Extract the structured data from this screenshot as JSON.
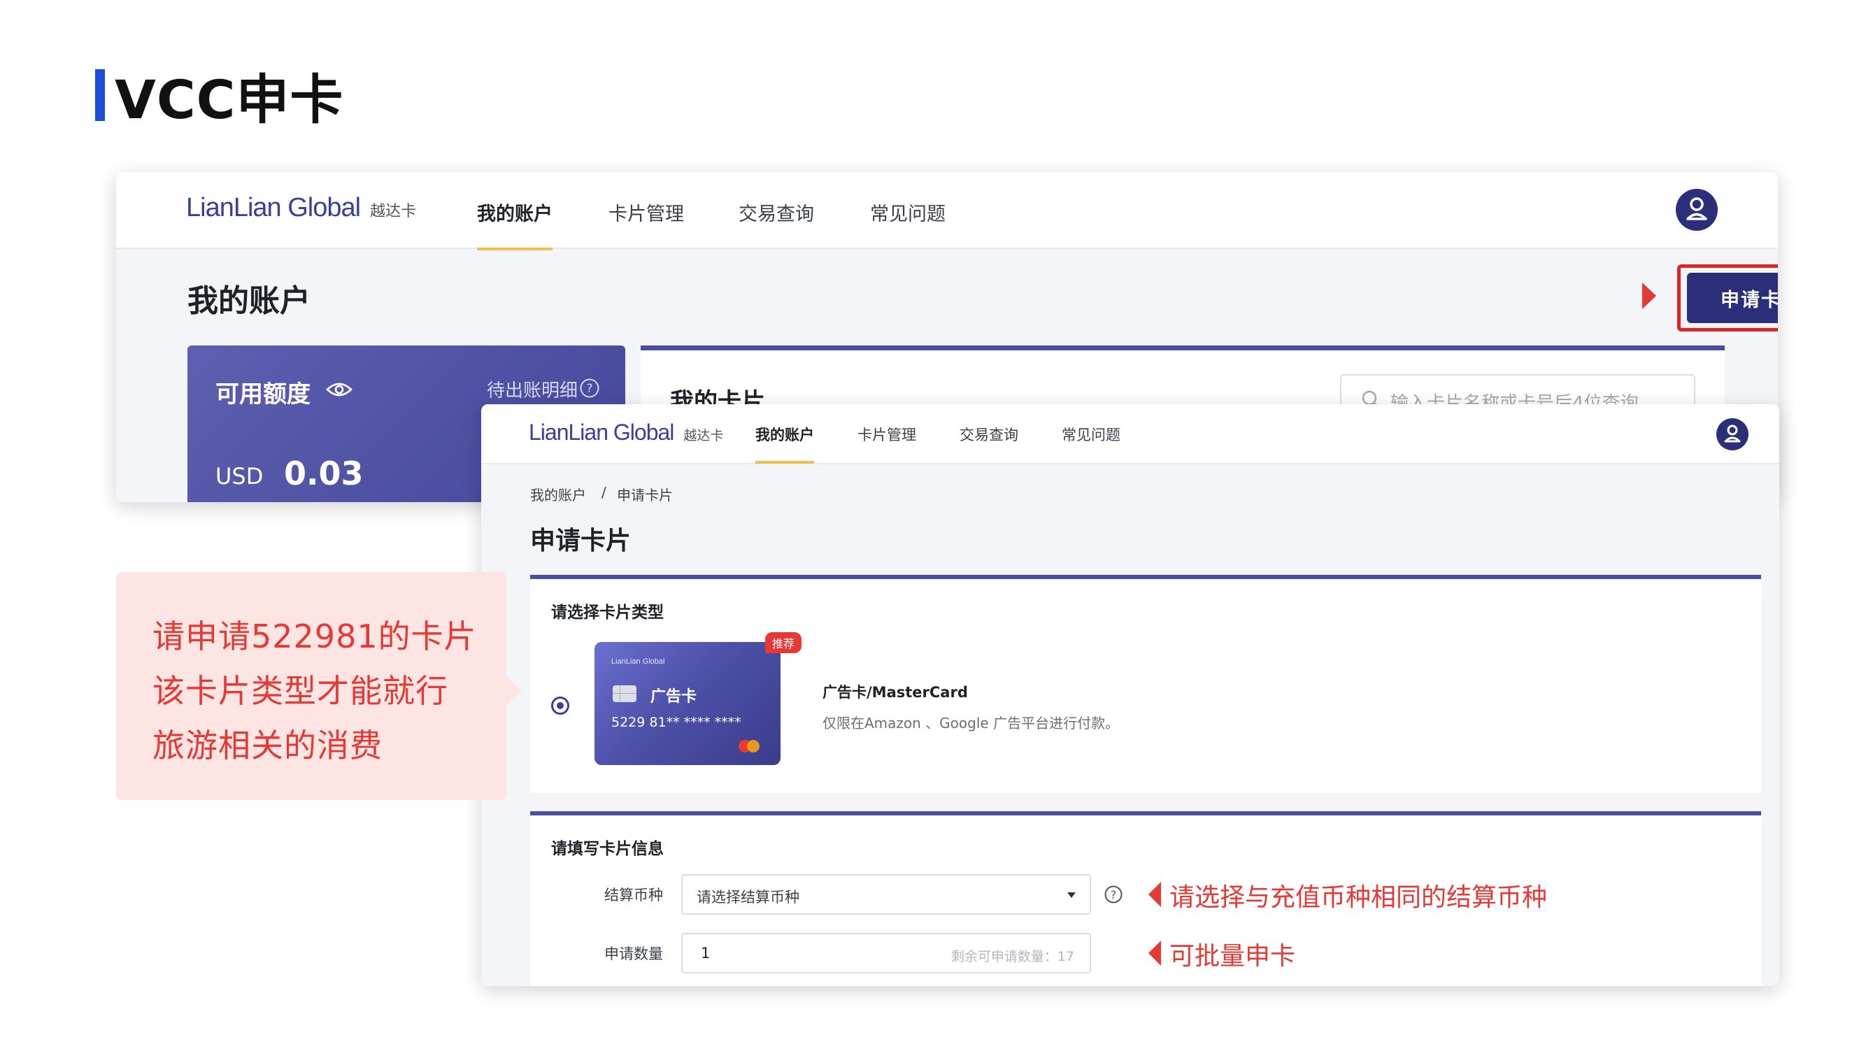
{
  "slide": {
    "title": "VCC申卡"
  },
  "app": {
    "brand": "LianLian Global",
    "brand_sub": "越达卡",
    "nav": [
      "我的账户",
      "卡片管理",
      "交易查询",
      "常见问题"
    ],
    "active_nav": "我的账户"
  },
  "account_page": {
    "heading": "我的账户",
    "apply_button": "申请卡片",
    "balance_label": "可用额度",
    "pending_bill_link": "待出账明细",
    "currency": "USD",
    "amount": "0.03",
    "my_cards_title": "我的卡片",
    "search_placeholder": "输入卡片名称或卡号后4位查询"
  },
  "apply_page": {
    "breadcrumb": [
      "我的账户",
      "申请卡片"
    ],
    "breadcrumb_sep": "/",
    "heading": "申请卡片",
    "card_type_section": {
      "title": "请选择卡片类型",
      "card": {
        "logo": "LianLian Global",
        "name": "广告卡",
        "number": "5229 81** **** ****",
        "badge": "推荐",
        "type_name": "广告卡/MasterCard",
        "description": "仅限在Amazon 、Google 广告平台进行付款。",
        "selected": true
      }
    },
    "card_info_section": {
      "title": "请填写卡片信息",
      "currency_label": "结算币种",
      "currency_placeholder": "请选择结算币种",
      "quantity_label": "申请数量",
      "quantity_value": "1",
      "quantity_hint": "剩余可申请数量：17"
    }
  },
  "annotations": {
    "callout_lines": [
      "请申请522981的卡片",
      "该卡片类型才能就行",
      "旅游相关的消费"
    ],
    "currency_note": "请选择与充值币种相同的结算币种",
    "batch_note": "可批量申卡"
  },
  "colors": {
    "accent_blue": "#1d4ed8",
    "primary_navy": "#2b2f7a",
    "highlight_red": "#e02424",
    "nav_underline": "#f1c24b",
    "callout_bg": "#fde5e3"
  },
  "icons": [
    "eye-icon",
    "help-icon",
    "search-icon",
    "user-avatar-icon",
    "chevron-down-icon",
    "mastercard-icon",
    "card-chip-icon"
  ]
}
